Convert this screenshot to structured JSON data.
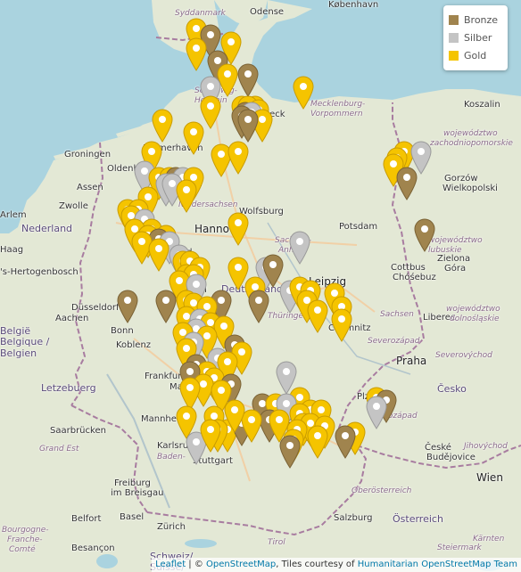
{
  "legend": {
    "items": [
      {
        "label": "Bronze",
        "color": "#a0844e"
      },
      {
        "label": "Silber",
        "color": "#c4c4c4"
      },
      {
        "label": "Gold",
        "color": "#f5c400"
      }
    ]
  },
  "attribution": {
    "leaflet": "Leaflet",
    "sep1": " | © ",
    "osm": "OpenStreetMap",
    "sep2": ", Tiles courtesy of ",
    "hot": "Humanitarian OpenStreetMap Team"
  },
  "colors": {
    "sea": "#aad3df",
    "land": "#e3e8d5",
    "gold": "#f5c400",
    "silber": "#c4c4c4",
    "bronze": "#a0844e"
  },
  "labels": [
    {
      "text": "København",
      "cls": "city"
    },
    {
      "text": "Odense",
      "cls": "city"
    },
    {
      "text": "Syddanmark",
      "cls": "pl"
    },
    {
      "text": "Schleswig-",
      "cls": "state"
    },
    {
      "text": "Holstein",
      "cls": "state"
    },
    {
      "text": "Lübeck",
      "cls": "city"
    },
    {
      "text": "Mecklenburg-",
      "cls": "state"
    },
    {
      "text": "Vorpommern",
      "cls": "state"
    },
    {
      "text": "Koszalin",
      "cls": "city"
    },
    {
      "text": "województwo",
      "cls": "pl"
    },
    {
      "text": "zachodniopomorskie",
      "cls": "pl"
    },
    {
      "text": "Groningen",
      "cls": "city"
    },
    {
      "text": "Oldenburg",
      "cls": "city"
    },
    {
      "text": "Bremerhaven",
      "cls": "city"
    },
    {
      "text": "Bremen",
      "cls": "bigcity"
    },
    {
      "text": "Assen",
      "cls": "city"
    },
    {
      "text": "Zwolle",
      "cls": "city"
    },
    {
      "text": "Niedersachsen",
      "cls": "state"
    },
    {
      "text": "Wolfsburg",
      "cls": "city"
    },
    {
      "text": "Hannover",
      "cls": "bigcity"
    },
    {
      "text": "Potsdam",
      "cls": "city"
    },
    {
      "text": "Gorzów",
      "cls": "city"
    },
    {
      "text": "Wielkopolski",
      "cls": "city"
    },
    {
      "text": "województwo",
      "cls": "pl"
    },
    {
      "text": "lubuskie",
      "cls": "pl"
    },
    {
      "text": "Nederland",
      "cls": "country"
    },
    {
      "text": "Haag",
      "cls": "city"
    },
    {
      "text": "Arlem",
      "cls": "city"
    },
    {
      "text": "'s-Hertogenbosch",
      "cls": "city"
    },
    {
      "text": "Bielefeld",
      "cls": "city"
    },
    {
      "text": "Sachsen-",
      "cls": "state"
    },
    {
      "text": "Anhalt",
      "cls": "state"
    },
    {
      "text": "Zielona",
      "cls": "city"
    },
    {
      "text": "Góra",
      "cls": "city"
    },
    {
      "text": "Cottbus",
      "cls": "city"
    },
    {
      "text": "Chóśebuz",
      "cls": "city"
    },
    {
      "text": "Leipzig",
      "cls": "bigcity"
    },
    {
      "text": "Kassel",
      "cls": "city"
    },
    {
      "text": "Deutschland",
      "cls": "country"
    },
    {
      "text": "Düsseldorf",
      "cls": "city"
    },
    {
      "text": "Aachen",
      "cls": "city"
    },
    {
      "text": "Bonn",
      "cls": "city"
    },
    {
      "text": "Thüringen",
      "cls": "state"
    },
    {
      "text": "Chemnitz",
      "cls": "city"
    },
    {
      "text": "Sachsen",
      "cls": "state"
    },
    {
      "text": "Liberec",
      "cls": "city"
    },
    {
      "text": "województwo",
      "cls": "pl"
    },
    {
      "text": "dolnośląskie",
      "cls": "pl"
    },
    {
      "text": "België",
      "cls": "country"
    },
    {
      "text": "Belgique /",
      "cls": "country"
    },
    {
      "text": "Belgien",
      "cls": "country"
    },
    {
      "text": "Koblenz",
      "cls": "city"
    },
    {
      "text": "Frankfurt am",
      "cls": "city"
    },
    {
      "text": "Main",
      "cls": "city"
    },
    {
      "text": "Severozápad",
      "cls": "pl"
    },
    {
      "text": "Praha",
      "cls": "bigcity"
    },
    {
      "text": "Severovýchod",
      "cls": "pl"
    },
    {
      "text": "Letzebuerg",
      "cls": "country"
    },
    {
      "text": "Saarbrücken",
      "cls": "city"
    },
    {
      "text": "Mannheim",
      "cls": "city"
    },
    {
      "text": "Nürnberg",
      "cls": "bigcity"
    },
    {
      "text": "Plzeň",
      "cls": "city"
    },
    {
      "text": "Česko",
      "cls": "country"
    },
    {
      "text": "Jihozápad",
      "cls": "pl"
    },
    {
      "text": "Bayern",
      "cls": "state"
    },
    {
      "text": "Grand Est",
      "cls": "pl"
    },
    {
      "text": "Karlsruhe",
      "cls": "city"
    },
    {
      "text": "Baden-",
      "cls": "state"
    },
    {
      "text": "Stuttgart",
      "cls": "city"
    },
    {
      "text": "České",
      "cls": "city"
    },
    {
      "text": "Budějovice",
      "cls": "city"
    },
    {
      "text": "Jihovýchod",
      "cls": "pl"
    },
    {
      "text": "Freiburg",
      "cls": "city"
    },
    {
      "text": "im Breisgau",
      "cls": "city"
    },
    {
      "text": "Oberösterreich",
      "cls": "state"
    },
    {
      "text": "Wien",
      "cls": "bigcity"
    },
    {
      "text": "Belfort",
      "cls": "city"
    },
    {
      "text": "Basel",
      "cls": "city"
    },
    {
      "text": "Zürich",
      "cls": "city"
    },
    {
      "text": "Salzburg",
      "cls": "city"
    },
    {
      "text": "Österreich",
      "cls": "country"
    },
    {
      "text": "Besançon",
      "cls": "city"
    },
    {
      "text": "Bourgogne-",
      "cls": "pl"
    },
    {
      "text": "Franche-",
      "cls": "pl"
    },
    {
      "text": "Comté",
      "cls": "pl"
    },
    {
      "text": "Schweiz/",
      "cls": "country"
    },
    {
      "text": "Suisse/",
      "cls": "country"
    },
    {
      "text": "Tirol",
      "cls": "state"
    },
    {
      "text": "Steiermark",
      "cls": "state"
    },
    {
      "text": "Kärnten",
      "cls": "state"
    }
  ],
  "markers": [
    {
      "lat": 54.8,
      "lon": 8.3,
      "medal": "gold"
    },
    {
      "lat": 54.7,
      "lon": 8.7,
      "medal": "bronze"
    },
    {
      "lat": 54.5,
      "lon": 8.3,
      "medal": "gold"
    },
    {
      "lat": 54.6,
      "lon": 9.3,
      "medal": "gold"
    },
    {
      "lat": 54.3,
      "lon": 8.9,
      "medal": "bronze"
    },
    {
      "lat": 54.1,
      "lon": 9.2,
      "medal": "gold"
    },
    {
      "lat": 54.1,
      "lon": 9.8,
      "medal": "bronze"
    },
    {
      "lat": 53.9,
      "lon": 8.7,
      "medal": "silber"
    },
    {
      "lat": 53.9,
      "lon": 11.4,
      "medal": "gold"
    },
    {
      "lat": 53.6,
      "lon": 10.0,
      "medal": "gold"
    },
    {
      "lat": 53.6,
      "lon": 8.7,
      "medal": "gold"
    },
    {
      "lat": 53.6,
      "lon": 9.6,
      "medal": "gold"
    },
    {
      "lat": 53.6,
      "lon": 9.8,
      "medal": "gold"
    },
    {
      "lat": 53.55,
      "lon": 10.1,
      "medal": "gold"
    },
    {
      "lat": 53.5,
      "lon": 9.7,
      "medal": "bronze"
    },
    {
      "lat": 53.5,
      "lon": 9.9,
      "medal": "silber"
    },
    {
      "lat": 53.45,
      "lon": 9.6,
      "medal": "bronze"
    },
    {
      "lat": 53.4,
      "lon": 10.2,
      "medal": "gold"
    },
    {
      "lat": 53.4,
      "lon": 9.8,
      "medal": "bronze"
    },
    {
      "lat": 53.4,
      "lon": 7.3,
      "medal": "gold"
    },
    {
      "lat": 53.2,
      "lon": 8.2,
      "medal": "gold"
    },
    {
      "lat": 52.9,
      "lon": 7.0,
      "medal": "gold"
    },
    {
      "lat": 52.85,
      "lon": 9.0,
      "medal": "gold"
    },
    {
      "lat": 52.9,
      "lon": 9.5,
      "medal": "gold"
    },
    {
      "lat": 52.9,
      "lon": 14.3,
      "medal": "gold"
    },
    {
      "lat": 52.8,
      "lon": 14.1,
      "medal": "gold"
    },
    {
      "lat": 52.9,
      "lon": 14.8,
      "medal": "silber"
    },
    {
      "lat": 52.7,
      "lon": 14.0,
      "medal": "gold"
    },
    {
      "lat": 52.5,
      "lon": 14.4,
      "medal": "bronze"
    },
    {
      "lat": 52.6,
      "lon": 6.8,
      "medal": "silber"
    },
    {
      "lat": 52.5,
      "lon": 7.2,
      "medal": "gold"
    },
    {
      "lat": 52.5,
      "lon": 7.5,
      "medal": "gold"
    },
    {
      "lat": 52.5,
      "lon": 7.7,
      "medal": "bronze"
    },
    {
      "lat": 52.5,
      "lon": 7.9,
      "medal": "silber"
    },
    {
      "lat": 52.5,
      "lon": 8.2,
      "medal": "gold"
    },
    {
      "lat": 52.4,
      "lon": 7.4,
      "medal": "silber"
    },
    {
      "lat": 52.4,
      "lon": 7.6,
      "medal": "silber"
    },
    {
      "lat": 52.3,
      "lon": 8.0,
      "medal": "gold"
    },
    {
      "lat": 52.2,
      "lon": 6.9,
      "medal": "gold"
    },
    {
      "lat": 52.0,
      "lon": 6.3,
      "medal": "gold"
    },
    {
      "lat": 52.0,
      "lon": 6.6,
      "medal": "gold"
    },
    {
      "lat": 51.9,
      "lon": 6.4,
      "medal": "gold"
    },
    {
      "lat": 51.85,
      "lon": 6.8,
      "medal": "silber"
    },
    {
      "lat": 51.8,
      "lon": 9.5,
      "medal": "gold"
    },
    {
      "lat": 51.7,
      "lon": 14.9,
      "medal": "bronze"
    },
    {
      "lat": 51.7,
      "lon": 7.0,
      "medal": "gold"
    },
    {
      "lat": 51.7,
      "lon": 6.5,
      "medal": "gold"
    },
    {
      "lat": 51.6,
      "lon": 6.9,
      "medal": "gold"
    },
    {
      "lat": 51.6,
      "lon": 7.4,
      "medal": "gold"
    },
    {
      "lat": 51.55,
      "lon": 7.2,
      "medal": "bronze"
    },
    {
      "lat": 51.5,
      "lon": 6.7,
      "medal": "gold"
    },
    {
      "lat": 51.5,
      "lon": 7.5,
      "medal": "silber"
    },
    {
      "lat": 51.4,
      "lon": 7.2,
      "medal": "gold"
    },
    {
      "lat": 51.5,
      "lon": 11.3,
      "medal": "silber"
    },
    {
      "lat": 51.3,
      "lon": 7.8,
      "medal": "silber"
    },
    {
      "lat": 51.2,
      "lon": 7.9,
      "medal": "gold"
    },
    {
      "lat": 51.2,
      "lon": 8.1,
      "medal": "gold"
    },
    {
      "lat": 51.1,
      "lon": 8.4,
      "medal": "gold"
    },
    {
      "lat": 51.1,
      "lon": 10.3,
      "medal": "silber"
    },
    {
      "lat": 51.15,
      "lon": 10.5,
      "medal": "bronze"
    },
    {
      "lat": 51.0,
      "lon": 8.0,
      "medal": "gold"
    },
    {
      "lat": 51.0,
      "lon": 8.2,
      "medal": "gold"
    },
    {
      "lat": 51.1,
      "lon": 9.5,
      "medal": "gold"
    },
    {
      "lat": 50.9,
      "lon": 7.8,
      "medal": "gold"
    },
    {
      "lat": 50.85,
      "lon": 8.3,
      "medal": "silber"
    },
    {
      "lat": 50.8,
      "lon": 10.0,
      "medal": "gold"
    },
    {
      "lat": 50.75,
      "lon": 11.0,
      "medal": "silber"
    },
    {
      "lat": 50.8,
      "lon": 11.3,
      "medal": "gold"
    },
    {
      "lat": 50.75,
      "lon": 11.6,
      "medal": "gold"
    },
    {
      "lat": 50.7,
      "lon": 12.3,
      "medal": "gold"
    },
    {
      "lat": 50.6,
      "lon": 6.3,
      "medal": "bronze"
    },
    {
      "lat": 50.6,
      "lon": 7.4,
      "medal": "bronze"
    },
    {
      "lat": 50.6,
      "lon": 8.0,
      "medal": "gold"
    },
    {
      "lat": 50.55,
      "lon": 8.2,
      "medal": "gold"
    },
    {
      "lat": 50.6,
      "lon": 9.0,
      "medal": "bronze"
    },
    {
      "lat": 50.6,
      "lon": 10.1,
      "medal": "bronze"
    },
    {
      "lat": 50.6,
      "lon": 11.5,
      "medal": "gold"
    },
    {
      "lat": 50.5,
      "lon": 12.5,
      "medal": "gold"
    },
    {
      "lat": 50.5,
      "lon": 8.6,
      "medal": "gold"
    },
    {
      "lat": 50.45,
      "lon": 11.8,
      "medal": "gold"
    },
    {
      "lat": 50.35,
      "lon": 8.0,
      "medal": "gold"
    },
    {
      "lat": 50.3,
      "lon": 8.4,
      "medal": "silber"
    },
    {
      "lat": 50.3,
      "lon": 12.5,
      "medal": "gold"
    },
    {
      "lat": 50.25,
      "lon": 8.7,
      "medal": "gold"
    },
    {
      "lat": 50.2,
      "lon": 9.1,
      "medal": "gold"
    },
    {
      "lat": 50.15,
      "lon": 8.3,
      "medal": "silber"
    },
    {
      "lat": 50.1,
      "lon": 7.9,
      "medal": "gold"
    },
    {
      "lat": 50.05,
      "lon": 8.6,
      "medal": "gold"
    },
    {
      "lat": 49.95,
      "lon": 8.2,
      "medal": "silber"
    },
    {
      "lat": 49.9,
      "lon": 9.4,
      "medal": "bronze"
    },
    {
      "lat": 49.85,
      "lon": 8.0,
      "medal": "gold"
    },
    {
      "lat": 49.8,
      "lon": 9.6,
      "medal": "gold"
    },
    {
      "lat": 49.7,
      "lon": 8.9,
      "medal": "silber"
    },
    {
      "lat": 49.65,
      "lon": 9.2,
      "medal": "gold"
    },
    {
      "lat": 49.6,
      "lon": 8.3,
      "medal": "bronze"
    },
    {
      "lat": 49.5,
      "lon": 8.6,
      "medal": "gold"
    },
    {
      "lat": 49.5,
      "lon": 8.1,
      "medal": "bronze"
    },
    {
      "lat": 49.5,
      "lon": 10.9,
      "medal": "silber"
    },
    {
      "lat": 49.4,
      "lon": 8.8,
      "medal": "gold"
    },
    {
      "lat": 49.3,
      "lon": 8.5,
      "medal": "gold"
    },
    {
      "lat": 49.3,
      "lon": 9.3,
      "medal": "bronze"
    },
    {
      "lat": 49.25,
      "lon": 8.1,
      "medal": "gold"
    },
    {
      "lat": 49.2,
      "lon": 9.0,
      "medal": "gold"
    },
    {
      "lat": 49.1,
      "lon": 11.3,
      "medal": "gold"
    },
    {
      "lat": 49.1,
      "lon": 13.5,
      "medal": "gold"
    },
    {
      "lat": 49.05,
      "lon": 13.8,
      "medal": "bronze"
    },
    {
      "lat": 49.0,
      "lon": 10.2,
      "medal": "bronze"
    },
    {
      "lat": 49.0,
      "lon": 10.6,
      "medal": "gold"
    },
    {
      "lat": 49.0,
      "lon": 10.9,
      "medal": "silber"
    },
    {
      "lat": 48.95,
      "lon": 13.5,
      "medal": "silber"
    },
    {
      "lat": 48.9,
      "lon": 11.6,
      "medal": "gold"
    },
    {
      "lat": 48.9,
      "lon": 11.9,
      "medal": "gold"
    },
    {
      "lat": 48.85,
      "lon": 11.3,
      "medal": "gold"
    },
    {
      "lat": 48.8,
      "lon": 8.0,
      "medal": "gold"
    },
    {
      "lat": 48.8,
      "lon": 8.8,
      "medal": "gold"
    },
    {
      "lat": 48.75,
      "lon": 10.4,
      "medal": "bronze"
    },
    {
      "lat": 48.75,
      "lon": 10.7,
      "medal": "gold"
    },
    {
      "lat": 48.7,
      "lon": 11.4,
      "medal": "gold"
    },
    {
      "lat": 48.7,
      "lon": 11.6,
      "medal": "gold"
    },
    {
      "lat": 48.65,
      "lon": 12.0,
      "medal": "gold"
    },
    {
      "lat": 48.6,
      "lon": 9.2,
      "medal": "gold"
    },
    {
      "lat": 48.6,
      "lon": 11.2,
      "medal": "gold"
    },
    {
      "lat": 48.55,
      "lon": 12.9,
      "medal": "gold"
    },
    {
      "lat": 48.5,
      "lon": 12.6,
      "medal": "bronze"
    },
    {
      "lat": 48.5,
      "lon": 11.8,
      "medal": "gold"
    },
    {
      "lat": 48.45,
      "lon": 11.1,
      "medal": "gold"
    },
    {
      "lat": 48.4,
      "lon": 8.3,
      "medal": "silber"
    },
    {
      "lat": 48.35,
      "lon": 11.0,
      "medal": "bronze"
    },
    {
      "lat": 48.6,
      "lon": 8.9,
      "medal": "gold"
    },
    {
      "lat": 48.6,
      "lon": 8.7,
      "medal": "gold"
    },
    {
      "lat": 48.7,
      "lon": 9.6,
      "medal": "bronze"
    },
    {
      "lat": 48.75,
      "lon": 9.9,
      "medal": "gold"
    },
    {
      "lat": 48.9,
      "lon": 9.4,
      "medal": "gold"
    }
  ]
}
